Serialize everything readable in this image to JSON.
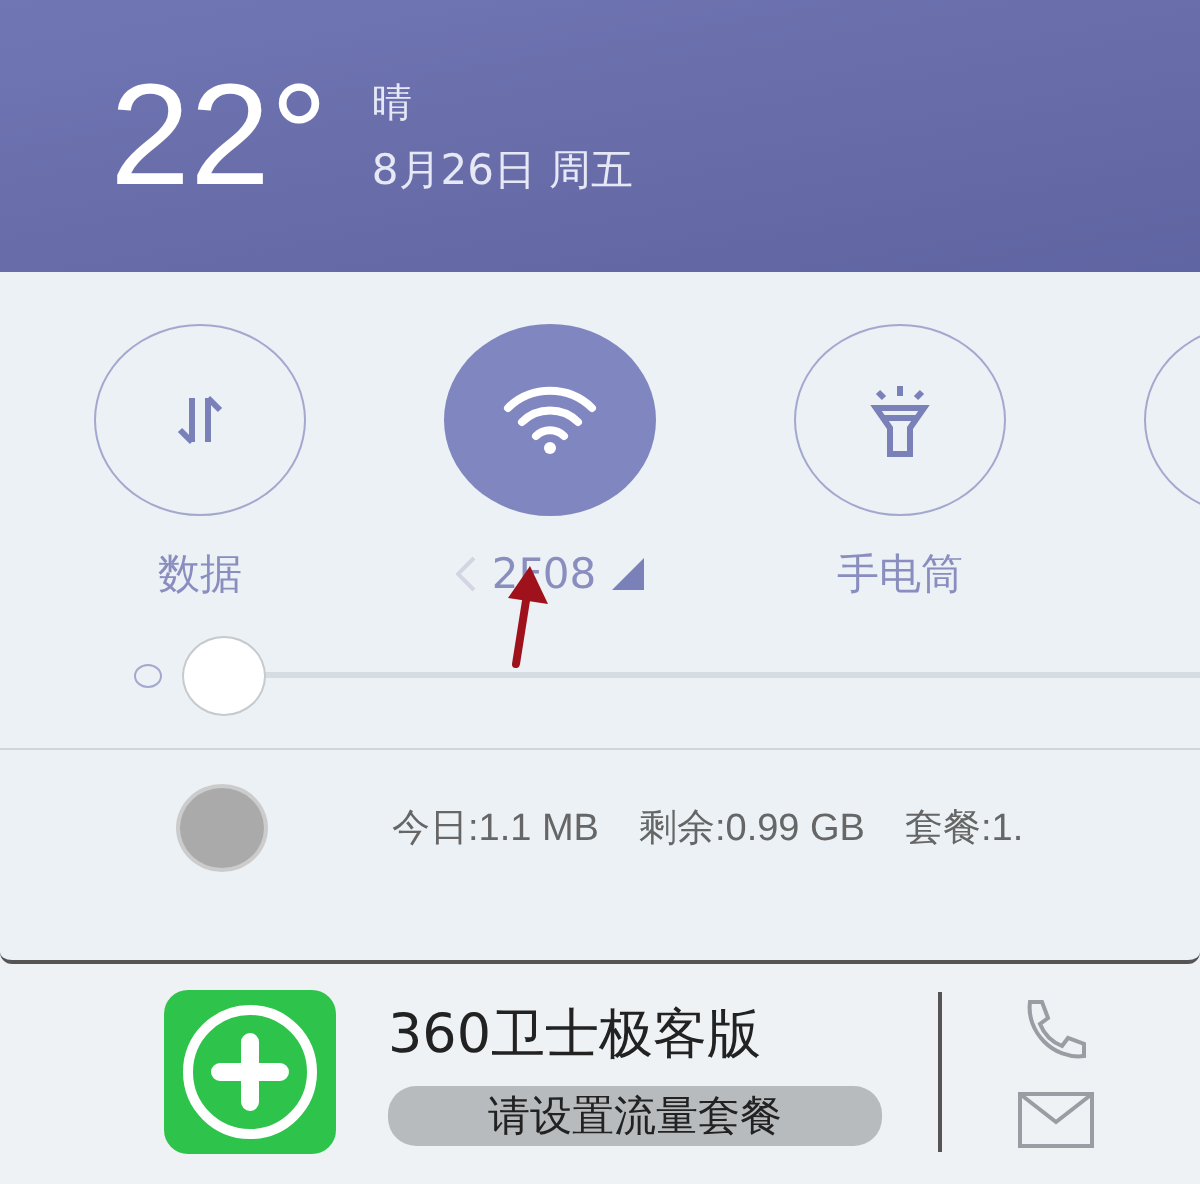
{
  "weather": {
    "temperature": "22°",
    "condition": "晴",
    "date": "8月26日 周五"
  },
  "toggles": [
    {
      "kind": "data",
      "label": "数据",
      "on": false
    },
    {
      "kind": "wifi",
      "label": "2F08",
      "on": true
    },
    {
      "kind": "flashlight",
      "label": "手电筒",
      "on": false
    },
    {
      "kind": "partial",
      "on": false
    }
  ],
  "brightness": {
    "level": 0.0
  },
  "usage": {
    "today": "今日:1.1 MB",
    "remaining": "剩余:0.99 GB",
    "plan": "套餐:1."
  },
  "app": {
    "name": "360卫士极客版",
    "badge": "请设置流量套餐"
  }
}
